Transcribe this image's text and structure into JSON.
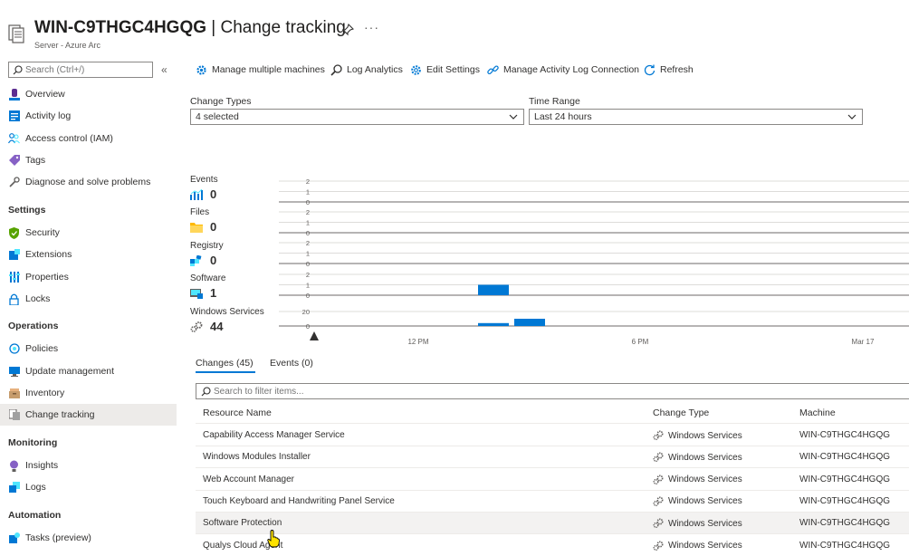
{
  "header": {
    "title_bold": "WIN-C9THGC4HGQG",
    "title_rest": " | Change tracking",
    "subtitle": "Server - Azure Arc",
    "more": "···"
  },
  "sidebar": {
    "search_placeholder": "Search (Ctrl+/)",
    "collapse": "«",
    "top_items": [
      {
        "label": "Overview",
        "icon": "overview-icon"
      },
      {
        "label": "Activity log",
        "icon": "activity-log-icon"
      },
      {
        "label": "Access control (IAM)",
        "icon": "people-icon"
      },
      {
        "label": "Tags",
        "icon": "tag-icon"
      },
      {
        "label": "Diagnose and solve problems",
        "icon": "wrench-icon"
      }
    ],
    "sections": [
      {
        "title": "Settings",
        "items": [
          {
            "label": "Security",
            "icon": "shield-icon"
          },
          {
            "label": "Extensions",
            "icon": "extensions-icon"
          },
          {
            "label": "Properties",
            "icon": "properties-icon"
          },
          {
            "label": "Locks",
            "icon": "lock-icon"
          }
        ]
      },
      {
        "title": "Operations",
        "items": [
          {
            "label": "Policies",
            "icon": "policy-icon"
          },
          {
            "label": "Update management",
            "icon": "update-icon"
          },
          {
            "label": "Inventory",
            "icon": "inventory-icon"
          },
          {
            "label": "Change tracking",
            "icon": "change-tracking-icon",
            "active": true
          }
        ]
      },
      {
        "title": "Monitoring",
        "items": [
          {
            "label": "Insights",
            "icon": "insights-icon"
          },
          {
            "label": "Logs",
            "icon": "logs-icon"
          }
        ]
      },
      {
        "title": "Automation",
        "items": [
          {
            "label": "Tasks (preview)",
            "icon": "tasks-icon"
          }
        ]
      }
    ]
  },
  "toolbar": {
    "manage_multiple": "Manage multiple machines",
    "log_analytics": "Log Analytics",
    "edit_settings": "Edit Settings",
    "manage_activity": "Manage Activity Log Connection",
    "refresh": "Refresh"
  },
  "filters": {
    "change_types_label": "Change Types",
    "change_types_value": "4 selected",
    "time_range_label": "Time Range",
    "time_range_value": "Last 24 hours"
  },
  "summary": {
    "events": {
      "label": "Events",
      "value": "0"
    },
    "files": {
      "label": "Files",
      "value": "0"
    },
    "registry": {
      "label": "Registry",
      "value": "0"
    },
    "software": {
      "label": "Software",
      "value": "1"
    },
    "windows_services": {
      "label": "Windows Services",
      "value": "44"
    }
  },
  "chart_data": {
    "type": "bar",
    "x_ticks": [
      "12 PM",
      "6 PM",
      "Mar 17"
    ],
    "series": [
      {
        "name": "Events",
        "ticks": [
          "2",
          "1",
          "0"
        ],
        "bars": []
      },
      {
        "name": "Files",
        "ticks": [
          "2",
          "1",
          "0"
        ],
        "bars": []
      },
      {
        "name": "Registry",
        "ticks": [
          "2",
          "1",
          "0"
        ],
        "bars": []
      },
      {
        "name": "Software",
        "ticks": [
          "2",
          "1",
          "0"
        ],
        "bars": [
          {
            "slot": 0,
            "value": 1
          }
        ]
      },
      {
        "name": "Windows Services",
        "ticks": [
          "20",
          "0"
        ],
        "bars": [
          {
            "slot": 0,
            "value": 4
          },
          {
            "slot": 1,
            "value": 10
          }
        ]
      }
    ],
    "bar_color": "#0078d4"
  },
  "tabs": {
    "changes": "Changes (45)",
    "events": "Events (0)"
  },
  "table": {
    "search_placeholder": "Search to filter items...",
    "headers": [
      "Resource Name",
      "Change Type",
      "Machine"
    ],
    "rows": [
      [
        "Capability Access Manager Service",
        "Windows Services",
        "WIN-C9THGC4HGQG"
      ],
      [
        "Windows Modules Installer",
        "Windows Services",
        "WIN-C9THGC4HGQG"
      ],
      [
        "Web Account Manager",
        "Windows Services",
        "WIN-C9THGC4HGQG"
      ],
      [
        "Touch Keyboard and Handwriting Panel Service",
        "Windows Services",
        "WIN-C9THGC4HGQG"
      ],
      [
        "Software Protection",
        "Windows Services",
        "WIN-C9THGC4HGQG"
      ],
      [
        "Qualys Cloud Agent",
        "Windows Services",
        "WIN-C9THGC4HGQG"
      ]
    ]
  }
}
